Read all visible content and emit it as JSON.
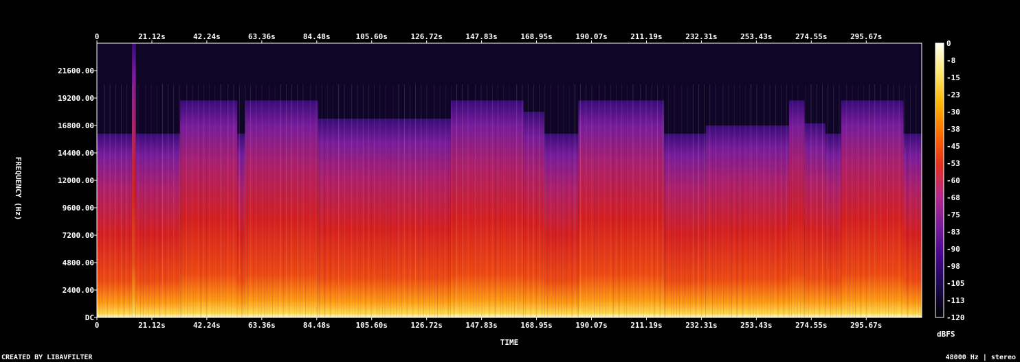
{
  "chart_data": {
    "type": "heatmap",
    "xlabel": "TIME",
    "ylabel": "FREQUENCY (Hz)",
    "colorbar_label": "dBFS",
    "x_ticks": [
      "0",
      "21.12s",
      "42.24s",
      "63.36s",
      "84.48s",
      "105.60s",
      "126.72s",
      "147.83s",
      "168.95s",
      "190.07s",
      "211.19s",
      "232.31s",
      "253.43s",
      "274.55s",
      "295.67s"
    ],
    "x_tick_values": [
      0,
      21.12,
      42.24,
      63.36,
      84.48,
      105.6,
      126.72,
      147.83,
      168.95,
      190.07,
      211.19,
      232.31,
      253.43,
      274.55,
      295.67
    ],
    "xlim": [
      0,
      317
    ],
    "y_ticks": [
      "DC",
      "2400.00",
      "4800.00",
      "7200.00",
      "9600.00",
      "12000.00",
      "14400.00",
      "16800.00",
      "19200.00",
      "21600.00"
    ],
    "y_tick_values": [
      0,
      2400,
      4800,
      7200,
      9600,
      12000,
      14400,
      16800,
      19200,
      21600
    ],
    "ylim": [
      0,
      24000
    ],
    "colorbar_ticks": [
      "0",
      "-8",
      "-15",
      "-23",
      "-30",
      "-38",
      "-45",
      "-53",
      "-60",
      "-68",
      "-75",
      "-83",
      "-90",
      "-98",
      "-105",
      "-113",
      "-120"
    ],
    "colorbar_range": [
      -120,
      0
    ],
    "colormap": [
      "#000000",
      "#1a0a4d",
      "#47058c",
      "#7a1d9c",
      "#b52a8c",
      "#e5301e",
      "#ff6a00",
      "#ffb300",
      "#ffe66a",
      "#fffff0"
    ],
    "band_cutoffs": [
      {
        "t0": 0,
        "t1": 13.5,
        "f": 16100
      },
      {
        "t0": 13.5,
        "t1": 15,
        "f": 24000
      },
      {
        "t0": 15,
        "t1": 32,
        "f": 16100
      },
      {
        "t0": 32,
        "t1": 54,
        "f": 19000
      },
      {
        "t0": 54,
        "t1": 57,
        "f": 16100
      },
      {
        "t0": 57,
        "t1": 85,
        "f": 19000
      },
      {
        "t0": 85,
        "t1": 136,
        "f": 17400
      },
      {
        "t0": 136,
        "t1": 164,
        "f": 19000
      },
      {
        "t0": 164,
        "t1": 172,
        "f": 18000
      },
      {
        "t0": 172,
        "t1": 185,
        "f": 16100
      },
      {
        "t0": 185,
        "t1": 218,
        "f": 19000
      },
      {
        "t0": 218,
        "t1": 234,
        "f": 16100
      },
      {
        "t0": 234,
        "t1": 266,
        "f": 16800
      },
      {
        "t0": 266,
        "t1": 272,
        "f": 19000
      },
      {
        "t0": 272,
        "t1": 280,
        "f": 17000
      },
      {
        "t0": 280,
        "t1": 286,
        "f": 16100
      },
      {
        "t0": 286,
        "t1": 310,
        "f": 19000
      },
      {
        "t0": 310,
        "t1": 317,
        "f": 16100
      }
    ]
  },
  "footer": {
    "left": "CREATED BY LIBAVFILTER",
    "right": "48000 Hz | stereo"
  }
}
